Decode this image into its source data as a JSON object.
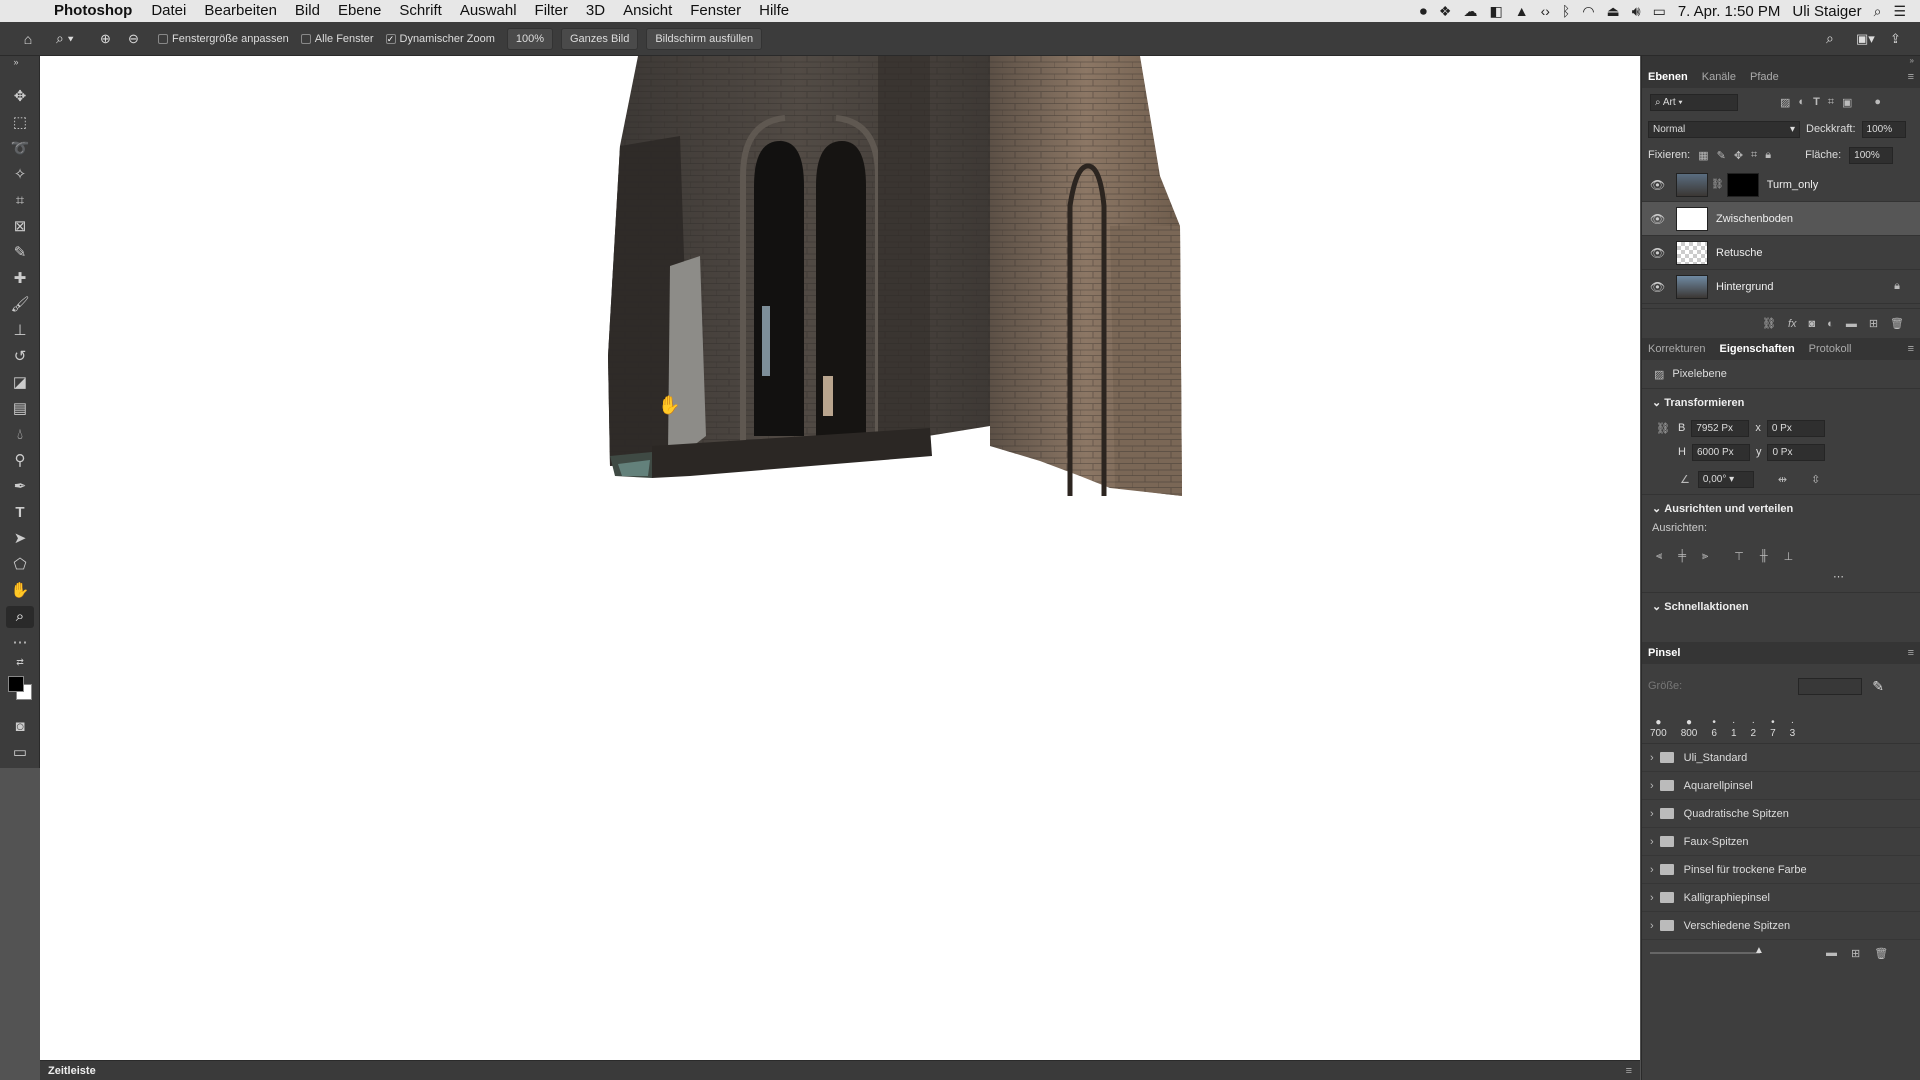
{
  "menubar": {
    "app_name": "Photoshop",
    "items": [
      "Datei",
      "Bearbeiten",
      "Bild",
      "Ebene",
      "Schrift",
      "Auswahl",
      "Filter",
      "3D",
      "Ansicht",
      "Fenster",
      "Hilfe"
    ],
    "datetime": "7. Apr. 1:50 PM",
    "user": "Uli Staiger"
  },
  "options": {
    "resize_windows": "Fenstergröße anpassen",
    "all_windows": "Alle Fenster",
    "scrubby_zoom": "Dynamischer Zoom",
    "zoom_value": "100%",
    "fit_screen": "Ganzes Bild",
    "fill_screen": "Bildschirm ausfüllen"
  },
  "layers_panel": {
    "tabs": [
      "Ebenen",
      "Kanäle",
      "Pfade"
    ],
    "filter_kind": "Art",
    "blend_mode": "Normal",
    "opacity_label": "Deckkraft:",
    "opacity_value": "100%",
    "lock_label": "Fixieren:",
    "fill_label": "Fläche:",
    "fill_value": "100%",
    "layers": [
      {
        "name": "Turm_only",
        "selected": false
      },
      {
        "name": "Zwischenboden",
        "selected": true
      },
      {
        "name": "Retusche",
        "selected": false
      },
      {
        "name": "Hintergrund",
        "selected": false
      }
    ]
  },
  "properties_panel": {
    "tabs": [
      "Korrekturen",
      "Eigenschaften",
      "Protokoll"
    ],
    "layer_type": "Pixelebene",
    "transform_title": "Transformieren",
    "w_label": "B",
    "w_value": "7952 Px",
    "h_label": "H",
    "h_value": "6000 Px",
    "x_label": "x",
    "x_value": "0 Px",
    "y_label": "y",
    "y_value": "0 Px",
    "angle_value": "0,00°",
    "align_title": "Ausrichten und verteilen",
    "align_label": "Ausrichten:",
    "quick_actions_title": "Schnellaktionen"
  },
  "brushes_panel": {
    "title": "Pinsel",
    "size_label": "Größe:",
    "presets": [
      "700",
      "800",
      "6",
      "1",
      "2",
      "7",
      "3"
    ],
    "folders": [
      "Uli_Standard",
      "Aquarellpinsel",
      "Quadratische Spitzen",
      "Faux-Spitzen",
      "Pinsel für trockene Farbe",
      "Kalligraphiepinsel",
      "Verschiedene Spitzen"
    ]
  },
  "timeline": {
    "label": "Zeitleiste"
  }
}
